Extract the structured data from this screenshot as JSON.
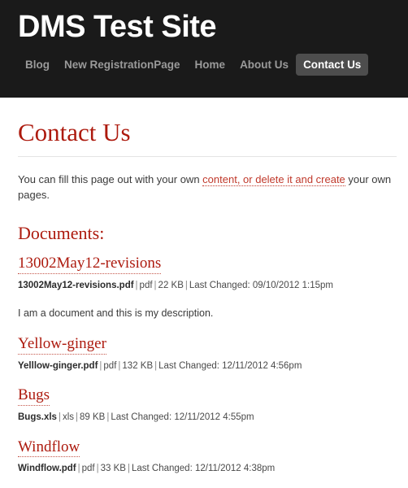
{
  "header": {
    "site_title": "DMS Test Site",
    "nav": [
      {
        "label": "Blog",
        "active": false
      },
      {
        "label": "New RegistrationPage",
        "active": false
      },
      {
        "label": "Home",
        "active": false
      },
      {
        "label": "About Us",
        "active": false
      },
      {
        "label": "Contact Us",
        "active": true
      }
    ]
  },
  "main": {
    "page_title": "Contact Us",
    "intro": {
      "before": "You can fill this page out with your own ",
      "link": "content, or delete it and create",
      "after": " your own pages."
    },
    "documents_heading": "Documents:",
    "documents": [
      {
        "title": "13002May12-revisions",
        "filename": "13002May12-revisions.pdf",
        "type": "pdf",
        "size": "22 KB",
        "changed_label": "Last Changed:",
        "changed": "09/10/2012 1:15pm",
        "description": "I am a document and this is my description."
      },
      {
        "title": "Yellow-ginger",
        "filename": "Yelllow-ginger.pdf",
        "type": "pdf",
        "size": "132 KB",
        "changed_label": "Last Changed:",
        "changed": "12/11/2012 4:56pm",
        "description": ""
      },
      {
        "title": "Bugs",
        "filename": "Bugs.xls",
        "type": "xls",
        "size": "89 KB",
        "changed_label": "Last Changed:",
        "changed": "12/11/2012 4:55pm",
        "description": ""
      },
      {
        "title": "Windflow",
        "filename": "Windflow.pdf",
        "type": "pdf",
        "size": "33 KB",
        "changed_label": "Last Changed:",
        "changed": "12/11/2012 4:38pm",
        "description": ""
      }
    ]
  },
  "colors": {
    "header_bg": "#1a1a1a",
    "accent_red": "#ad1a0e",
    "link_red": "#c0392b",
    "nav_inactive": "#9a9a9a",
    "nav_active_bg": "#4d4d4d"
  }
}
